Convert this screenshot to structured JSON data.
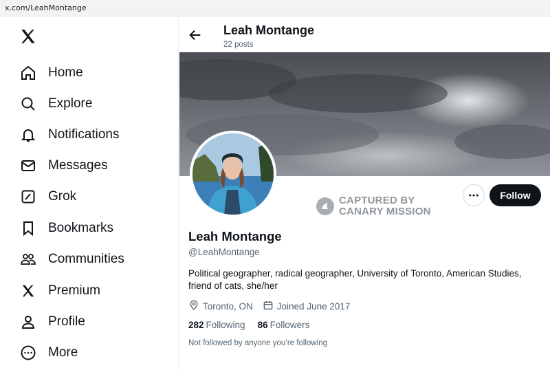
{
  "browser": {
    "url": "x.com/LeahMontange"
  },
  "sidebar": {
    "logo_icon": "x-logo-icon",
    "items": [
      {
        "label": "Home",
        "icon": "home-icon"
      },
      {
        "label": "Explore",
        "icon": "search-icon"
      },
      {
        "label": "Notifications",
        "icon": "bell-icon"
      },
      {
        "label": "Messages",
        "icon": "envelope-icon"
      },
      {
        "label": "Grok",
        "icon": "grok-icon"
      },
      {
        "label": "Bookmarks",
        "icon": "bookmark-icon"
      },
      {
        "label": "Communities",
        "icon": "people-icon"
      },
      {
        "label": "Premium",
        "icon": "x-logo-icon"
      },
      {
        "label": "Profile",
        "icon": "person-icon"
      },
      {
        "label": "More",
        "icon": "more-circle-icon"
      }
    ]
  },
  "header": {
    "title": "Leah Montange",
    "subtitle": "22 posts"
  },
  "profile": {
    "name": "Leah Montange",
    "handle": "@LeahMontange",
    "bio": "Political geographer, radical geographer, University of Toronto, American Studies, friend of cats, she/her",
    "location": "Toronto, ON",
    "joined": "Joined June 2017",
    "following_count": "282",
    "following_label": "Following",
    "followers_count": "86",
    "followers_label": "Followers",
    "not_followed": "Not followed by anyone you’re following",
    "follow_label": "Follow"
  },
  "watermark": {
    "line1": "CAPTURED BY",
    "line2": "CANARY MISSION"
  },
  "colors": {
    "text": "#0f1419",
    "muted": "#536471",
    "follow_bg": "#0f1419"
  }
}
